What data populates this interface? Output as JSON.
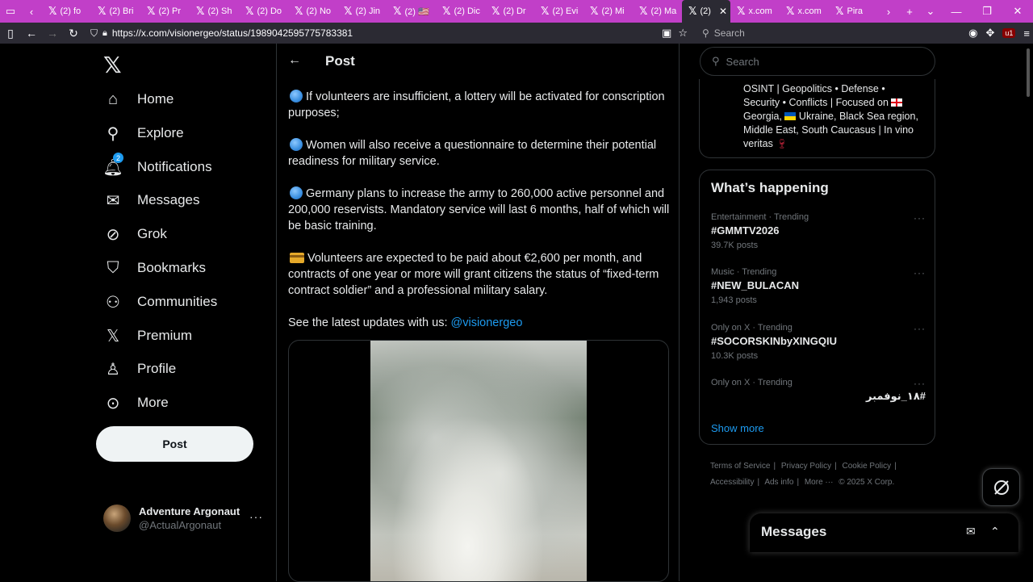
{
  "browser": {
    "tabs": [
      {
        "label": "(2) fo"
      },
      {
        "label": "(2) Bri"
      },
      {
        "label": "(2) Pr"
      },
      {
        "label": "(2) Sh"
      },
      {
        "label": "(2) Do"
      },
      {
        "label": "(2) No"
      },
      {
        "label": "(2) Jin"
      },
      {
        "label": "(2) 🇺🇸"
      },
      {
        "label": "(2) Dic"
      },
      {
        "label": "(2) Dr"
      },
      {
        "label": "(2) Evi"
      },
      {
        "label": "(2) Mi"
      },
      {
        "label": "(2) Ma"
      },
      {
        "label": "(2)",
        "active": true
      },
      {
        "label": "x.com"
      },
      {
        "label": "x.com"
      },
      {
        "label": "Pira"
      }
    ],
    "url": "https://x.com/visionergeo/status/1989042595775783381",
    "search_placeholder": "Search"
  },
  "sidebar": {
    "items": [
      {
        "label": "Home",
        "icon": "home-icon"
      },
      {
        "label": "Explore",
        "icon": "search-icon"
      },
      {
        "label": "Notifications",
        "icon": "bell-icon",
        "badge": "2"
      },
      {
        "label": "Messages",
        "icon": "mail-icon"
      },
      {
        "label": "Grok",
        "icon": "grok-icon"
      },
      {
        "label": "Bookmarks",
        "icon": "bookmark-icon"
      },
      {
        "label": "Communities",
        "icon": "people-icon"
      },
      {
        "label": "Premium",
        "icon": "x-icon"
      },
      {
        "label": "Profile",
        "icon": "person-icon"
      },
      {
        "label": "More",
        "icon": "more-circle-icon"
      }
    ],
    "post_button": "Post",
    "account": {
      "name": "Adventure Argonaut",
      "handle": "@ActualArgonaut"
    }
  },
  "main": {
    "title": "Post",
    "paragraphs": [
      "If volunteers are insufficient, a lottery will be activated for conscription purposes;",
      "Women will also receive a questionnaire to determine their potential readiness for military service.",
      "Germany plans to increase the army to 260,000 active personnel and 200,000 reservists. Mandatory service will last 6 months, half of which will be basic training.",
      "Volunteers are expected to be paid about €2,600 per month, and contracts of one year or more will grant citizens the status of “fixed-term contract soldier” and a professional military salary."
    ],
    "updates_text": "See the latest updates with us: ",
    "updates_mention": "@visionergeo"
  },
  "right": {
    "search_placeholder": "Search",
    "bio": {
      "line1": "OSINT | Geopolitics • Defense •",
      "line2": "Security • Conflicts | Focused on",
      "line3a": "Georgia,",
      "line3b": "Ukraine, Black Sea region,",
      "line4": "Middle East, South Caucasus | In vino",
      "line5": "veritas"
    },
    "happening_title": "What’s happening",
    "trends": [
      {
        "context": "Entertainment · Trending",
        "name": "#GMMTV2026",
        "count": "39.7K posts"
      },
      {
        "context": "Music · Trending",
        "name": "#NEW_BULACAN",
        "count": "1,943 posts"
      },
      {
        "context": "Only on X · Trending",
        "name": "#SOCORSKINbyXINGQIU",
        "count": "10.3K posts"
      },
      {
        "context": "Only on X · Trending",
        "name": "#١٨_نوفمبر",
        "count": ""
      }
    ],
    "show_more": "Show more",
    "footer": {
      "terms": "Terms of Service",
      "privacy": "Privacy Policy",
      "cookie": "Cookie Policy",
      "accessibility": "Accessibility",
      "ads": "Ads info",
      "more": "More ···",
      "copyright": "© 2025 X Corp."
    }
  },
  "messages_drawer": {
    "title": "Messages"
  },
  "colors": {
    "accent": "#1d9bf0",
    "tabbar": "#c13fc8",
    "background": "#000000"
  }
}
